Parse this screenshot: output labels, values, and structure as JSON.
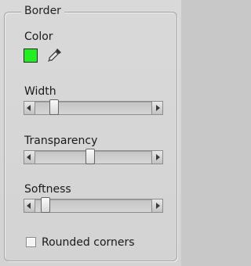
{
  "group": {
    "title": "Border"
  },
  "color": {
    "label": "Color",
    "swatch_color": "#22ee22",
    "picker_icon": "eyedropper-icon"
  },
  "width": {
    "label": "Width",
    "value": 0.13
  },
  "transparency": {
    "label": "Transparency",
    "value": 0.47
  },
  "softness": {
    "label": "Softness",
    "value": 0.05
  },
  "rounded_corners": {
    "label": "Rounded corners",
    "checked": false
  }
}
